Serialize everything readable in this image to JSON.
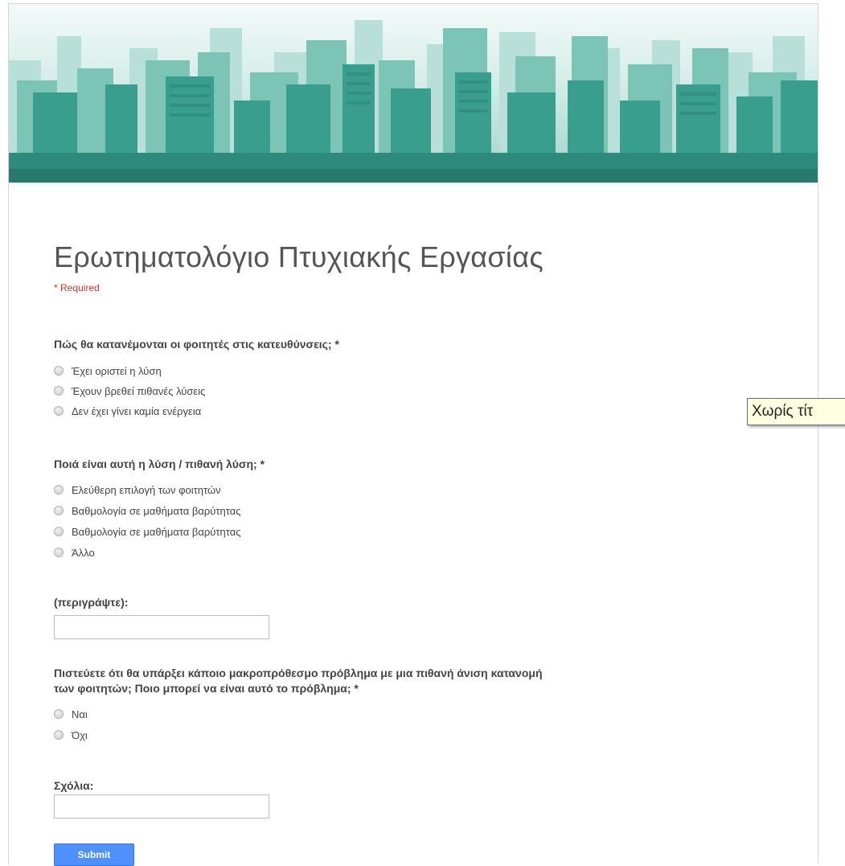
{
  "form": {
    "title": "Ερωτηματολόγιο Πτυχιακής Εργασίας",
    "required_note": "* Required"
  },
  "questions": [
    {
      "title": "Πώς θα κατανέμονται οι φοιτητές στις κατευθύνσεις; *",
      "options": [
        "Έχει οριστεί η λύση",
        "Έχουν βρεθεί πιθανές λύσεις",
        "Δεν έχει γίνει καμία ενέργεια"
      ]
    },
    {
      "title": "Ποιά είναι αυτή η λύση / πιθανή λύση; *",
      "options": [
        "Ελεύθερη επιλογή των φοιτητών",
        "Βαθμολογία σε μαθήματα βαρύτητας",
        "Βαθμολογία σε μαθήματα βαρύτητας",
        "Άλλο"
      ]
    },
    {
      "title": "(περιγράψτε):"
    },
    {
      "title_line1": "Πιστεύετε ότι θα υπάρξει κάποιο μακροπρόθεσμο πρόβλημα με μια πιθανή άνιση κατανομή",
      "title_line2": "των φοιτητών; Ποιο μπορεί να είναι αυτό το πρόβλημα; *",
      "options": [
        "Ναι",
        "Όχι"
      ]
    },
    {
      "title": "Σχόλια:"
    }
  ],
  "submit_label": "Submit",
  "tooltip": "Χωρίς τίτ",
  "colors": {
    "banner_teal": "#3a9e8f",
    "submit_blue": "#4d90fe",
    "required_red": "#c0392b"
  }
}
